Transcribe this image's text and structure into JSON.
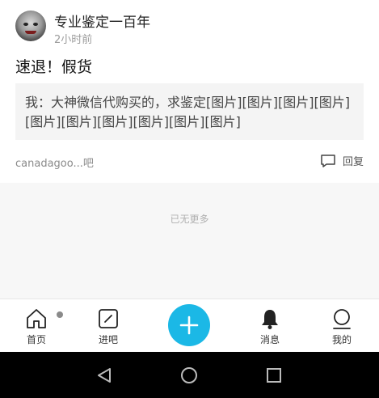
{
  "post": {
    "username": "专业鉴定一百年",
    "time": "2小时前",
    "title": "速退！假货",
    "quote": "我：大神微信代购买的，求鉴定[图片][图片][图片][图片][图片][图片][图片][图片][图片][图片]",
    "signature": "canadagoo...吧",
    "reply_label": "回复"
  },
  "feed": {
    "no_more_text": "已无更多"
  },
  "tabbar": {
    "tabs": [
      {
        "label": "首页",
        "icon": "home-icon"
      },
      {
        "label": "进吧",
        "icon": "enter-forum-icon"
      },
      {
        "label": "",
        "icon": "plus-icon"
      },
      {
        "label": "消息",
        "icon": "bell-icon"
      },
      {
        "label": "我的",
        "icon": "profile-icon"
      }
    ],
    "accent": "#1bb8e6"
  },
  "system_nav": {
    "icons": [
      "back-icon",
      "home-circle-icon",
      "recents-icon"
    ]
  }
}
